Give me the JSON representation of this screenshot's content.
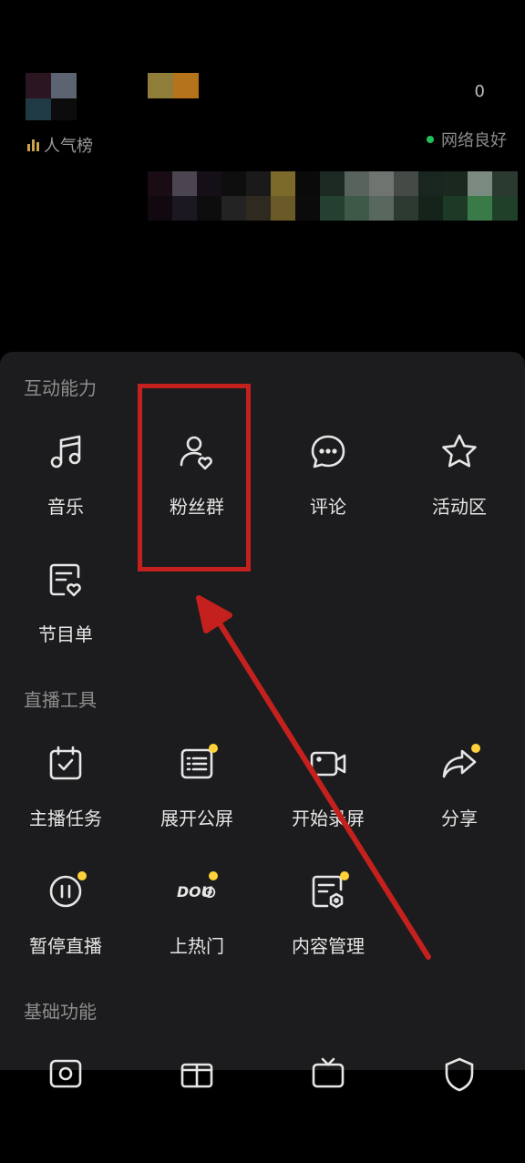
{
  "header": {
    "viewer_count": "0",
    "rank_label": "人气榜",
    "network_status": "网络良好"
  },
  "sections": [
    {
      "title": "互动能力",
      "items": [
        {
          "label": "音乐",
          "icon": "music-note-icon",
          "dot": false
        },
        {
          "label": "粉丝群",
          "icon": "fan-group-icon",
          "dot": false
        },
        {
          "label": "评论",
          "icon": "comment-bubble-icon",
          "dot": false
        },
        {
          "label": "活动区",
          "icon": "star-icon",
          "dot": false
        },
        {
          "label": "节目单",
          "icon": "program-list-icon",
          "dot": false
        }
      ]
    },
    {
      "title": "直播工具",
      "items": [
        {
          "label": "主播任务",
          "icon": "task-calendar-icon",
          "dot": false
        },
        {
          "label": "展开公屏",
          "icon": "public-screen-icon",
          "dot": true
        },
        {
          "label": "开始录屏",
          "icon": "video-camera-icon",
          "dot": false
        },
        {
          "label": "分享",
          "icon": "share-arrow-icon",
          "dot": true
        },
        {
          "label": "暂停直播",
          "icon": "pause-icon",
          "dot": true
        },
        {
          "label": "上热门",
          "icon": "dou-plus-icon",
          "dot": true
        },
        {
          "label": "内容管理",
          "icon": "content-manage-icon",
          "dot": true
        }
      ]
    },
    {
      "title": "基础功能",
      "items": []
    }
  ],
  "colors": {
    "panel_bg": "#1c1c1e",
    "badge": "#ffd23a",
    "annotation_red": "#c4211e",
    "network_dot": "#21c15a"
  }
}
